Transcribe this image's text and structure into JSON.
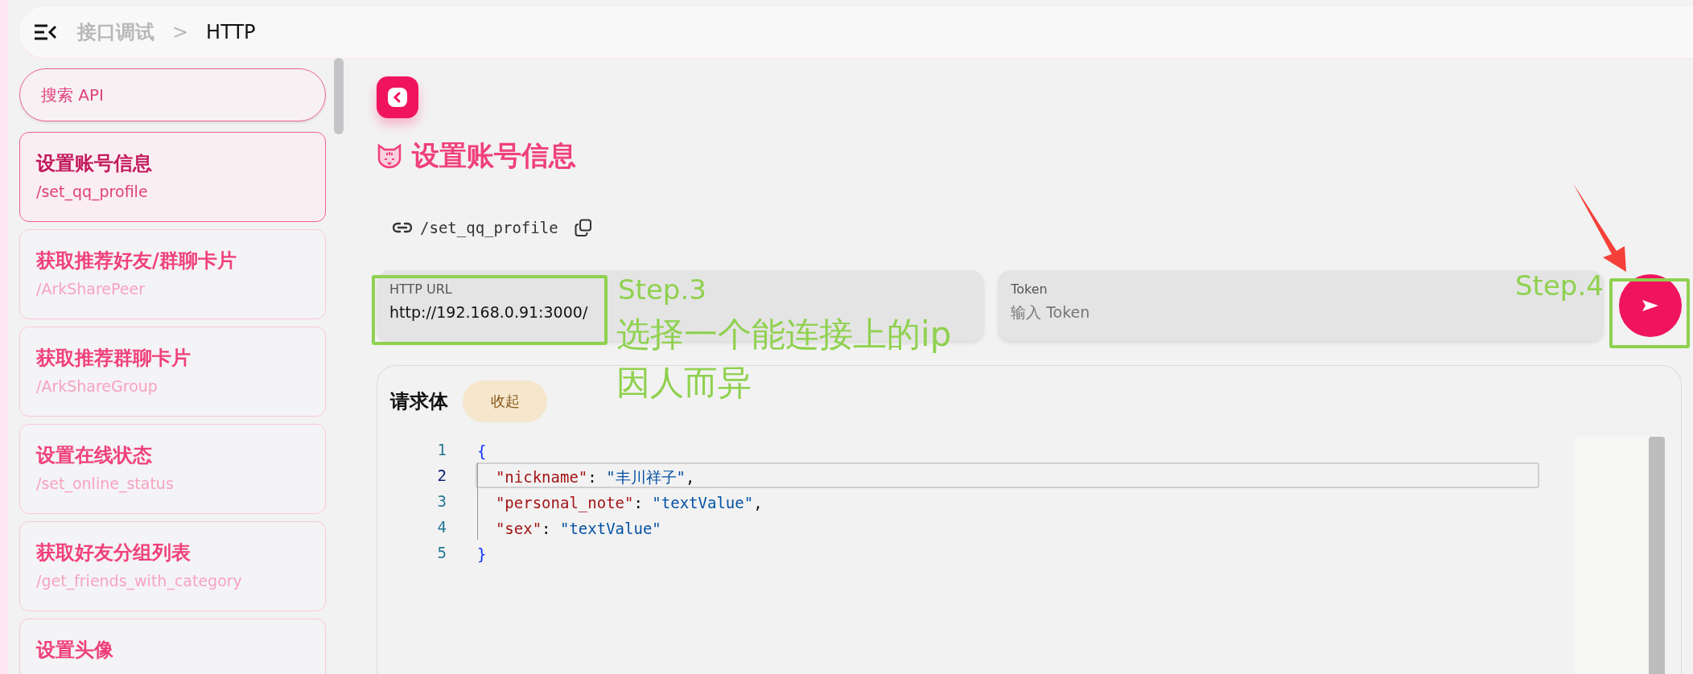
{
  "header": {
    "breadcrumb": [
      {
        "label": "接口调试",
        "selected": false
      },
      {
        "label": "HTTP",
        "selected": true
      }
    ],
    "separator": ">"
  },
  "sidebar": {
    "search": {
      "placeholder": "搜索 API"
    },
    "items": [
      {
        "title": "设置账号信息",
        "path": "/set_qq_profile",
        "selected": true
      },
      {
        "title": "获取推荐好友/群聊卡片",
        "path": "/ArkSharePeer",
        "selected": false
      },
      {
        "title": "获取推荐群聊卡片",
        "path": "/ArkShareGroup",
        "selected": false
      },
      {
        "title": "设置在线状态",
        "path": "/set_online_status",
        "selected": false
      },
      {
        "title": "获取好友分组列表",
        "path": "/get_friends_with_category",
        "selected": false
      },
      {
        "title": "设置头像",
        "selected": false
      }
    ]
  },
  "main": {
    "title": "设置账号信息",
    "endpoint": "/set_qq_profile",
    "fields": [
      {
        "label": "HTTP URL",
        "value": "http://192.168.0.91:3000/"
      },
      {
        "label": "Token",
        "placeholder": "输入 Token"
      }
    ],
    "request_body": {
      "title": "请求体",
      "collapse_button": "收起",
      "lines": [
        {
          "number": "1",
          "highlighted": false,
          "tokens": [
            {
              "kind": "brace",
              "text": "{"
            }
          ]
        },
        {
          "number": "2",
          "highlighted": true,
          "tokens": [
            {
              "kind": "key",
              "text": "  \"nickname\""
            },
            {
              "kind": "punct",
              "text": ": "
            },
            {
              "kind": "string",
              "text": "\"丰川祥子\""
            },
            {
              "kind": "punct",
              "text": ","
            }
          ]
        },
        {
          "number": "3",
          "highlighted": false,
          "tokens": [
            {
              "kind": "key",
              "text": "  \"personal_note\""
            },
            {
              "kind": "punct",
              "text": ": "
            },
            {
              "kind": "string",
              "text": "\"textValue\""
            },
            {
              "kind": "punct",
              "text": ","
            }
          ]
        },
        {
          "number": "4",
          "highlighted": false,
          "tokens": [
            {
              "kind": "key",
              "text": "  \"sex\""
            },
            {
              "kind": "punct",
              "text": ": "
            },
            {
              "kind": "string",
              "text": "\"textValue\""
            }
          ]
        },
        {
          "number": "5",
          "highlighted": false,
          "tokens": [
            {
              "kind": "brace",
              "text": "}"
            }
          ]
        }
      ]
    }
  },
  "annotations": [
    {
      "kind": "step",
      "text": "Step.3"
    },
    {
      "kind": "note",
      "text": "选择一个能连接上的ip"
    },
    {
      "kind": "note",
      "text": "因人而异"
    },
    {
      "kind": "step",
      "text": "Step.4"
    }
  ]
}
